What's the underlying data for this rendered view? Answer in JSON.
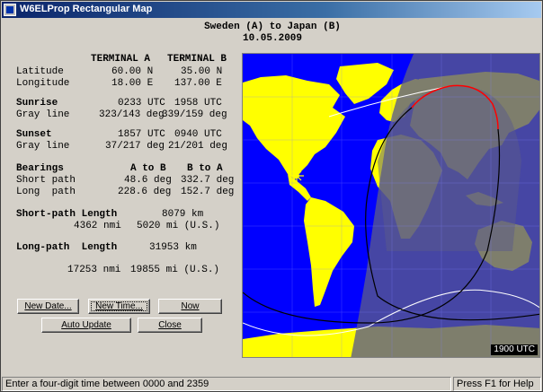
{
  "window": {
    "title": "W6ELProp Rectangular Map"
  },
  "heading": {
    "line1": "Sweden (A) to Japan (B)",
    "line2": "10.05.2009"
  },
  "table": {
    "col_a": "TERMINAL A",
    "col_b": "TERMINAL B",
    "latitude": {
      "label": "Latitude",
      "a": "60.00 N",
      "b": "35.00 N"
    },
    "longitude": {
      "label": "Longitude",
      "a": "18.00 E",
      "b": "137.00 E"
    },
    "sunrise": {
      "label": "Sunrise",
      "a": "0233 UTC",
      "b": "1958 UTC"
    },
    "gray_rise": {
      "label": "Gray line",
      "a": "323/143 deg",
      "b": "339/159 deg"
    },
    "sunset": {
      "label": "Sunset",
      "a": "1857 UTC",
      "b": "0940 UTC"
    },
    "gray_set": {
      "label": "Gray line",
      "a": "37/217 deg",
      "b": "21/201 deg"
    },
    "bearings": {
      "label": "Bearings",
      "a": "A to B",
      "b": "B to A"
    },
    "short_path": {
      "label": "Short path",
      "a": "48.6 deg",
      "b": "332.7 deg"
    },
    "long_path": {
      "label": "Long  path",
      "a": "228.6 deg",
      "b": "152.7 deg"
    }
  },
  "short_length": {
    "label": "Short-path Length",
    "km": "8079 km",
    "nmi": "4362 nmi",
    "mi": "5020 mi (U.S.)"
  },
  "long_length": {
    "label": "Long-path  Length",
    "km": "31953 km",
    "nmi": "17253 nmi",
    "mi": "19855 mi (U.S.)"
  },
  "buttons": {
    "new_date": "New Date...",
    "new_time": "New Time...",
    "now": "Now",
    "auto_update": "Auto Update",
    "close": "Close"
  },
  "map": {
    "utc": "1900 UTC",
    "colors": {
      "ocean": "#0000ff",
      "land": "#ffff00",
      "land_edge": "#00cc00",
      "night": "#5a5a8a",
      "short_path": "#ff0000",
      "long_path": "#000000",
      "grayline": "#ffffff",
      "sun": "#ffff00"
    }
  },
  "status": {
    "left": "Enter a four-digit time between 0000 and 2359",
    "right": "Press F1 for Help"
  }
}
